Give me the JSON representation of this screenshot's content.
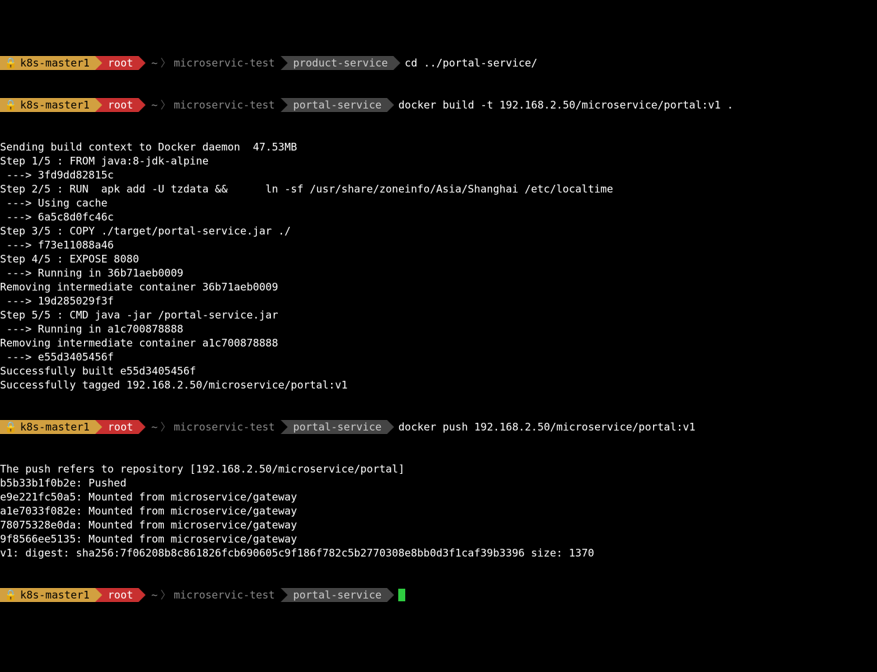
{
  "prompt": {
    "host": "k8s-master1",
    "user": "root",
    "tilde": "~",
    "proj": "microservic-test",
    "dir_product": "product-service",
    "dir_portal": "portal-service",
    "lock": "🔒"
  },
  "cmd1": "cd ../portal-service/",
  "cmd2": "docker build -t 192.168.2.50/microservice/portal:v1 .",
  "cmd3": "docker push 192.168.2.50/microservice/portal:v1",
  "build_output": [
    "Sending build context to Docker daemon  47.53MB",
    "Step 1/5 : FROM java:8-jdk-alpine",
    " ---> 3fd9dd82815c",
    "Step 2/5 : RUN  apk add -U tzdata &&      ln -sf /usr/share/zoneinfo/Asia/Shanghai /etc/localtime",
    " ---> Using cache",
    " ---> 6a5c8d0fc46c",
    "Step 3/5 : COPY ./target/portal-service.jar ./",
    " ---> f73e11088a46",
    "Step 4/5 : EXPOSE 8080",
    " ---> Running in 36b71aeb0009",
    "Removing intermediate container 36b71aeb0009",
    " ---> 19d285029f3f",
    "Step 5/5 : CMD java -jar /portal-service.jar",
    " ---> Running in a1c700878888",
    "Removing intermediate container a1c700878888",
    " ---> e55d3405456f",
    "Successfully built e55d3405456f",
    "Successfully tagged 192.168.2.50/microservice/portal:v1"
  ],
  "push_output": [
    "The push refers to repository [192.168.2.50/microservice/portal]",
    "b5b33b1f0b2e: Pushed",
    "e9e221fc50a5: Mounted from microservice/gateway",
    "a1e7033f082e: Mounted from microservice/gateway",
    "78075328e0da: Mounted from microservice/gateway",
    "9f8566ee5135: Mounted from microservice/gateway",
    "v1: digest: sha256:7f06208b8c861826fcb690605c9f186f782c5b2770308e8bb0d3f1caf39b3396 size: 1370"
  ]
}
